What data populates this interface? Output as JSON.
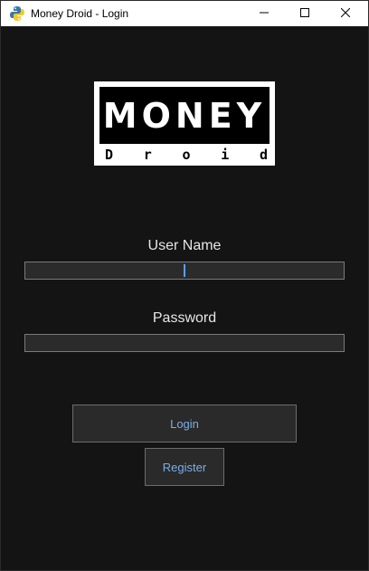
{
  "window": {
    "title": "Money Droid - Login"
  },
  "titlebar_icons": {
    "app": "python-icon",
    "minimize": "minimize-icon",
    "maximize": "maximize-icon",
    "close": "close-icon"
  },
  "logo": {
    "top": "MONEY",
    "bottom_letters": [
      "D",
      "r",
      "o",
      "i",
      "d"
    ]
  },
  "login_form": {
    "username_label": "User Name",
    "username_value": "",
    "password_label": "Password",
    "password_value": "",
    "login_button": "Login",
    "register_button": "Register"
  },
  "colors": {
    "background": "#141414",
    "input_background": "#2b2b2b",
    "button_text": "#79aee8",
    "label_text": "#e6e6e6",
    "caret": "#5aa0ff"
  }
}
